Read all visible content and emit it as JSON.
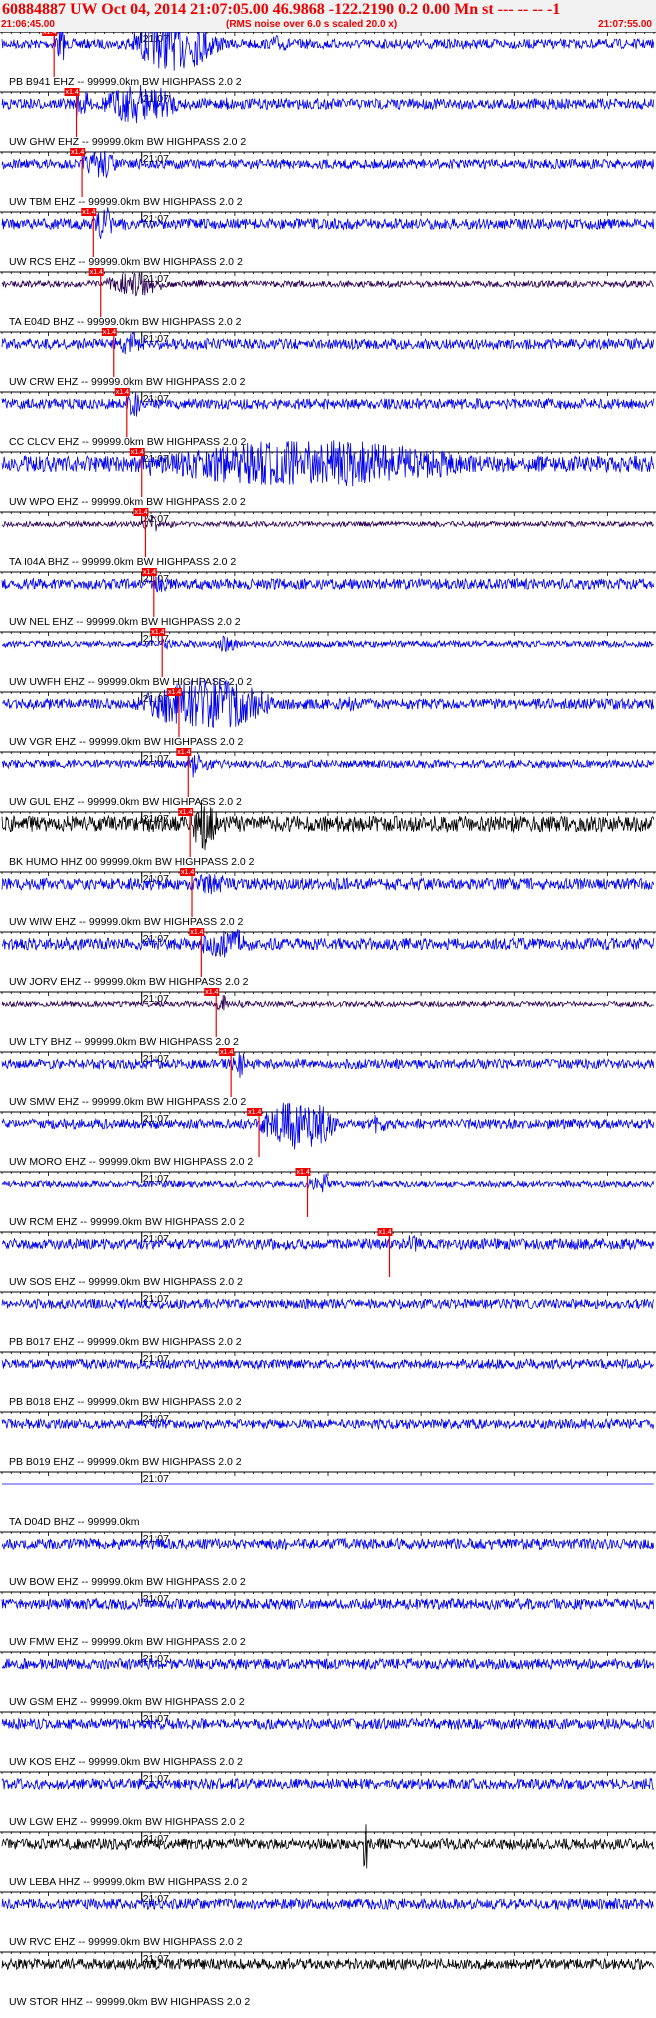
{
  "header": {
    "title": "60884887 UW Oct 04, 2014 21:07:05.00   46.9868 -122.2190  0.2 0.00 Mn st --- -- --  -1",
    "start_time": "21:06:45.00",
    "note": "(RMS noise over 6.0 s scaled 20.0 x)",
    "end_time": "21:07:55.00"
  },
  "colors": {
    "header_text": "#ee0000",
    "trace_default": "#0000ee",
    "trace_dark": "#2a0050",
    "trace_black": "#000000",
    "pick_box": "#ee0000",
    "grid": "#000000"
  },
  "chart_data": {
    "type": "line",
    "title": "",
    "xlabel": "",
    "ylabel": "",
    "x_range": [
      "21:06:45.00",
      "21:07:55.00"
    ],
    "minute_tick_label": "21:07",
    "minute_tick_time": "21:07:00.00",
    "pick_label": "x1.4",
    "series": [
      {
        "label": "PB B941 EHZ -- 99999.0km BW  HIGHPASS  2.0  2",
        "pick": "21:06:50.6",
        "color": "#0000ee",
        "burst_start": "21:06:58",
        "burst_end": "21:07:14",
        "burst_amp": 1.0,
        "noise": 0.18
      },
      {
        "label": "UW GHW EHZ -- 99999.0km BW  HIGHPASS  2.0  2",
        "pick": "21:06:53.0",
        "color": "#0000ee",
        "burst_start": "21:06:55",
        "burst_end": "21:07:09",
        "burst_amp": 0.75,
        "noise": 0.2
      },
      {
        "label": "UW TBM EHZ -- 99999.0km BW  HIGHPASS  2.0  2",
        "pick": "21:06:53.6",
        "color": "#0000ee",
        "burst_start": "21:06:54",
        "burst_end": "21:06:59",
        "burst_amp": 0.6,
        "noise": 0.18
      },
      {
        "label": "UW RCS EHZ -- 99999.0km BW  HIGHPASS  2.0  2",
        "pick": "21:06:54.8",
        "color": "#0000ee",
        "burst_start": "21:06:55",
        "burst_end": "21:06:58",
        "burst_amp": 0.7,
        "noise": 0.2
      },
      {
        "label": "TA E04D BHZ -- 99999.0km BW  HIGHPASS  2.0  2",
        "pick": "21:06:55.6",
        "color": "#2a0050",
        "burst_start": "21:06:56",
        "burst_end": "21:07:06",
        "burst_amp": 0.45,
        "noise": 0.12
      },
      {
        "label": "UW CRW EHZ -- 99999.0km BW  HIGHPASS  2.0  2",
        "pick": "21:06:57.0",
        "color": "#0000ee",
        "burst_start": "21:06:57",
        "burst_end": "21:07:03",
        "burst_amp": 0.45,
        "noise": 0.2
      },
      {
        "label": "CC CLCV EHZ -- 99999.0km BW  HIGHPASS  2.0  2",
        "pick": "21:06:58.4",
        "color": "#0000ee",
        "burst_start": "21:06:58",
        "burst_end": "21:07:01",
        "burst_amp": 0.55,
        "noise": 0.2
      },
      {
        "label": "UW WPO EHZ -- 99999.0km BW  HIGHPASS  2.0  2",
        "pick": "21:07:00.0",
        "color": "#0000ee",
        "burst_start": "21:06:59",
        "burst_end": "21:07:55",
        "burst_amp": 0.9,
        "noise": 0.3
      },
      {
        "label": "TA I04A BHZ -- 99999.0km BW  HIGHPASS  2.0  2",
        "pick": "21:07:00.4",
        "color": "#2a0050",
        "burst_start": "21:07:00",
        "burst_end": "21:07:03",
        "burst_amp": 0.35,
        "noise": 0.1
      },
      {
        "label": "UW NEL EHZ -- 99999.0km BW  HIGHPASS  2.0  2",
        "pick": "21:07:01.3",
        "color": "#0000ee",
        "burst_start": "21:07:01",
        "burst_end": "21:07:04",
        "burst_amp": 0.35,
        "noise": 0.2
      },
      {
        "label": "UW UWFH EHZ -- 99999.0km BW  HIGHPASS  2.0  2",
        "pick": "21:07:02.2",
        "color": "#0000ee",
        "burst_start": "21:07:07",
        "burst_end": "21:07:13",
        "burst_amp": 0.3,
        "noise": 0.12
      },
      {
        "label": "UW VGR EHZ -- 99999.0km BW  HIGHPASS  2.0  2",
        "pick": "21:07:04.0",
        "color": "#0000ee",
        "burst_start": "21:06:59",
        "burst_end": "21:07:22",
        "burst_amp": 1.0,
        "noise": 0.2
      },
      {
        "label": "UW GUL EHZ -- 99999.0km BW  HIGHPASS  2.0  2",
        "pick": "21:07:05.0",
        "color": "#0000ee",
        "burst_start": "21:07:05",
        "burst_end": "21:07:07",
        "burst_amp": 0.55,
        "noise": 0.15
      },
      {
        "label": "BK HUMO HHZ 00 99999.0km BW  HIGHPASS  2.0  2",
        "pick": "21:07:05.2",
        "color": "#000000",
        "burst_start": "21:07:05",
        "burst_end": "21:07:10",
        "burst_amp": 1.0,
        "noise": 0.3
      },
      {
        "label": "UW WIW EHZ -- 99999.0km BW  HIGHPASS  2.0  2",
        "pick": "21:07:05.4",
        "color": "#0000ee",
        "burst_start": "21:07:05",
        "burst_end": "21:07:12",
        "burst_amp": 0.45,
        "noise": 0.22
      },
      {
        "label": "UW JORV EHZ -- 99999.0km BW  HIGHPASS  2.0  2",
        "pick": "21:07:06.4",
        "color": "#0000ee",
        "burst_start": "21:07:06",
        "burst_end": "21:07:16",
        "burst_amp": 0.6,
        "noise": 0.22
      },
      {
        "label": "UW LTY BHZ -- 99999.0km BW  HIGHPASS  2.0  2",
        "pick": "21:07:08.0",
        "color": "#2a0050",
        "burst_start": "21:07:08",
        "burst_end": "21:07:10",
        "burst_amp": 0.45,
        "noise": 0.1
      },
      {
        "label": "UW SMW EHZ -- 99999.0km BW  HIGHPASS  2.0  2",
        "pick": "21:07:09.6",
        "color": "#0000ee",
        "burst_start": "21:07:10",
        "burst_end": "21:07:12",
        "burst_amp": 0.55,
        "noise": 0.18
      },
      {
        "label": "UW MORO EHZ -- 99999.0km BW  HIGHPASS  2.0  2",
        "pick": "21:07:12.6",
        "color": "#0000ee",
        "burst_start": "21:07:13",
        "burst_end": "21:07:25",
        "burst_amp": 1.0,
        "noise": 0.18
      },
      {
        "label": "UW RCM EHZ -- 99999.0km BW  HIGHPASS  2.0  2",
        "pick": "21:07:17.8",
        "color": "#0000ee",
        "burst_start": "21:07:19",
        "burst_end": "21:07:21",
        "burst_amp": 0.4,
        "noise": 0.12
      },
      {
        "label": "UW SOS EHZ -- 99999.0km BW  HIGHPASS  2.0  2",
        "pick": "21:07:26.6",
        "color": "#0000ee",
        "burst_start": "21:07:28",
        "burst_end": "21:07:31",
        "burst_amp": 0.35,
        "noise": 0.2
      },
      {
        "label": "PB B017 EHZ -- 99999.0km BW  HIGHPASS  2.0  2",
        "pick": null,
        "color": "#0000ee",
        "noise": 0.18
      },
      {
        "label": "PB B018 EHZ -- 99999.0km BW  HIGHPASS  2.0  2",
        "pick": null,
        "color": "#0000ee",
        "noise": 0.18
      },
      {
        "label": "PB B019 EHZ -- 99999.0km BW  HIGHPASS  2.0  2",
        "pick": null,
        "color": "#0000ee",
        "noise": 0.18
      },
      {
        "label": "TA D04D BHZ -- 99999.0km",
        "pick": null,
        "color": "#0000ee",
        "noise": 0.0
      },
      {
        "label": "UW BOW EHZ -- 99999.0km BW  HIGHPASS  2.0  2",
        "pick": null,
        "color": "#0000ee",
        "noise": 0.2
      },
      {
        "label": "UW FMW EHZ -- 99999.0km BW  HIGHPASS  2.0  2",
        "pick": null,
        "color": "#0000ee",
        "noise": 0.2
      },
      {
        "label": "UW GSM EHZ -- 99999.0km BW  HIGHPASS  2.0  2",
        "pick": null,
        "color": "#0000ee",
        "noise": 0.2
      },
      {
        "label": "UW KOS EHZ -- 99999.0km BW  HIGHPASS  2.0  2",
        "pick": null,
        "color": "#0000ee",
        "noise": 0.2
      },
      {
        "label": "UW LGW EHZ -- 99999.0km BW  HIGHPASS  2.0  2",
        "pick": null,
        "color": "#0000ee",
        "noise": 0.2
      },
      {
        "label": "UW LEBA HHZ -- 99999.0km BW  HIGHPASS  2.0  2",
        "pick": null,
        "color": "#000000",
        "noise": 0.2,
        "spike": "21:07:24"
      },
      {
        "label": "UW RVC EHZ -- 99999.0km BW  HIGHPASS  2.0  2",
        "pick": null,
        "color": "#0000ee",
        "noise": 0.2
      },
      {
        "label": "UW STOR HHZ -- 99999.0km BW  HIGHPASS  2.0  2",
        "pick": null,
        "color": "#000000",
        "noise": 0.2
      }
    ]
  }
}
